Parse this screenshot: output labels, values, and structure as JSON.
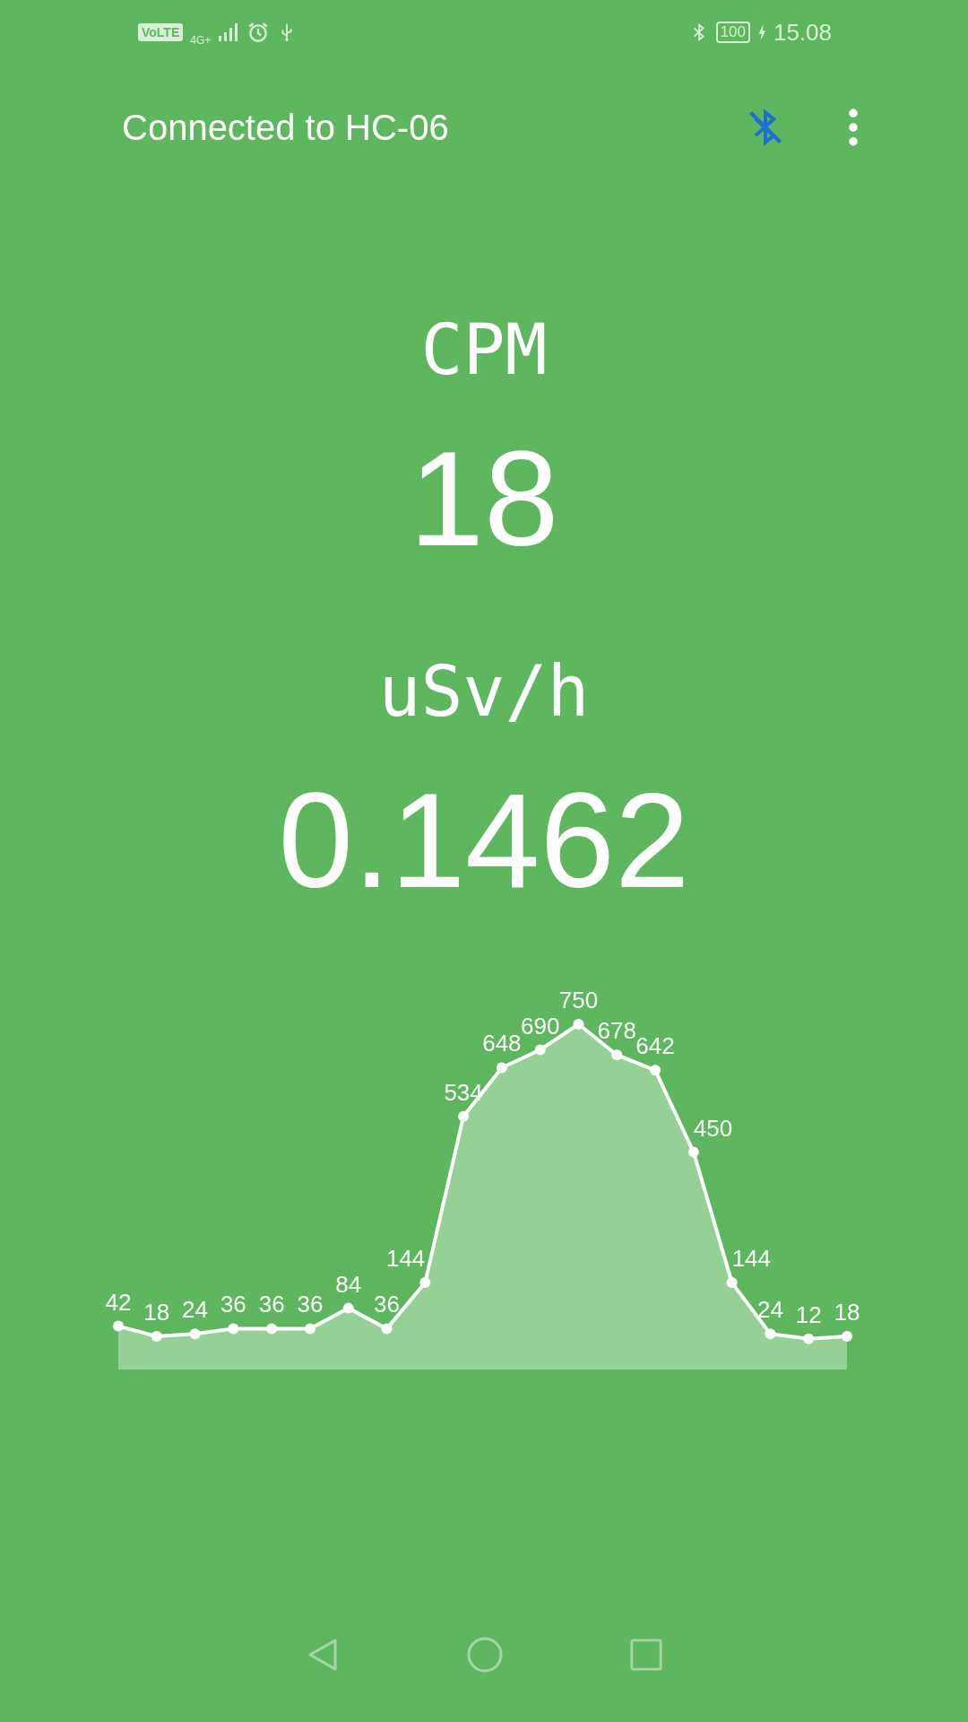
{
  "status_bar": {
    "network_badge": "VoLTE",
    "network_type": "4G+",
    "battery": "100",
    "time": "15.08"
  },
  "app_bar": {
    "title": "Connected to HC-06"
  },
  "readings": [
    {
      "label": "CPM",
      "value": "18"
    },
    {
      "label": "uSv/h",
      "value": "0.1462"
    }
  ],
  "chart": {
    "chart_data": {
      "type": "area",
      "data_labels": true,
      "categories": [
        null,
        null,
        null,
        null,
        null,
        null,
        null,
        null,
        null,
        null,
        null,
        null,
        null,
        null,
        null,
        null,
        null,
        null,
        null,
        null
      ],
      "series": [
        {
          "color": "#ffffff",
          "values": [
            42,
            18,
            24,
            36,
            36,
            36,
            84,
            36,
            144,
            534,
            648,
            690,
            750,
            678,
            642,
            450,
            144,
            24,
            12,
            18
          ]
        }
      ]
    }
  }
}
